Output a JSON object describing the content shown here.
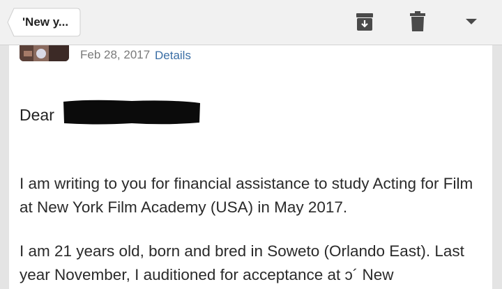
{
  "toolbar": {
    "back_label": "'New y...",
    "icons": [
      "archive-icon",
      "trash-icon",
      "chevron-down-icon"
    ]
  },
  "email": {
    "date": "Feb 28, 2017",
    "details_link": "Details",
    "greeting": "Dear",
    "paragraphs": [
      "I am writing to you for financial assistance to study Acting for Film at New York Film Academy (USA) in May 2017.",
      "I am 21 years old, born and bred in Soweto (Orlando East). Last year November, I auditioned for acceptance at ɔ´ New"
    ]
  },
  "colors": {
    "toolbar_bg": "#f1f1f1",
    "link": "#3a6ea5",
    "text": "#2a2a2a",
    "date_text": "#7a7a7a"
  }
}
